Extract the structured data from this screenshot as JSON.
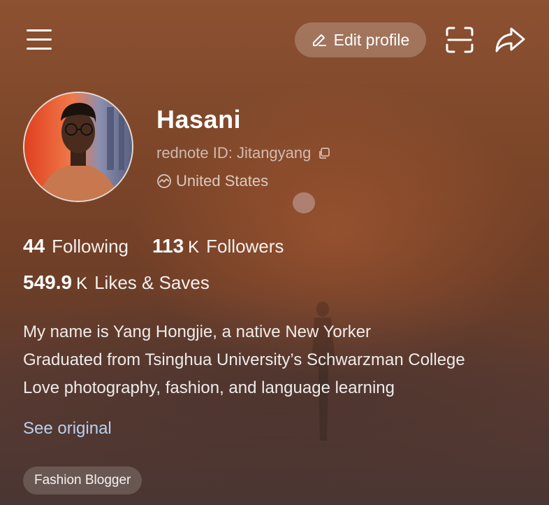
{
  "header": {
    "menu_icon": "hamburger-menu-icon",
    "edit_profile_label": "Edit profile",
    "edit_icon": "pencil-icon",
    "scan_icon": "scan-icon",
    "share_icon": "share-arrow-icon"
  },
  "profile": {
    "name": "Hasani",
    "rednote_id_label": "rednote ID: Jitangyang",
    "location": "United States"
  },
  "stats": {
    "following": {
      "value": "44",
      "label": "Following"
    },
    "followers": {
      "value": "113",
      "unit": "K",
      "label": "Followers"
    },
    "likes": {
      "value": "549.9",
      "unit": "K",
      "label": "Likes & Saves"
    }
  },
  "bio": {
    "lines": [
      "My name is Yang Hongjie, a native New Yorker",
      "Graduated from Tsinghua University’s Schwarzman College",
      "Love photography, fashion, and language learning"
    ],
    "see_original": "See original"
  },
  "tags": [
    "Fashion Blogger"
  ],
  "colors": {
    "link": "#b9d0f0",
    "background_top": "#8c5131",
    "background_bottom": "#4a3632"
  }
}
